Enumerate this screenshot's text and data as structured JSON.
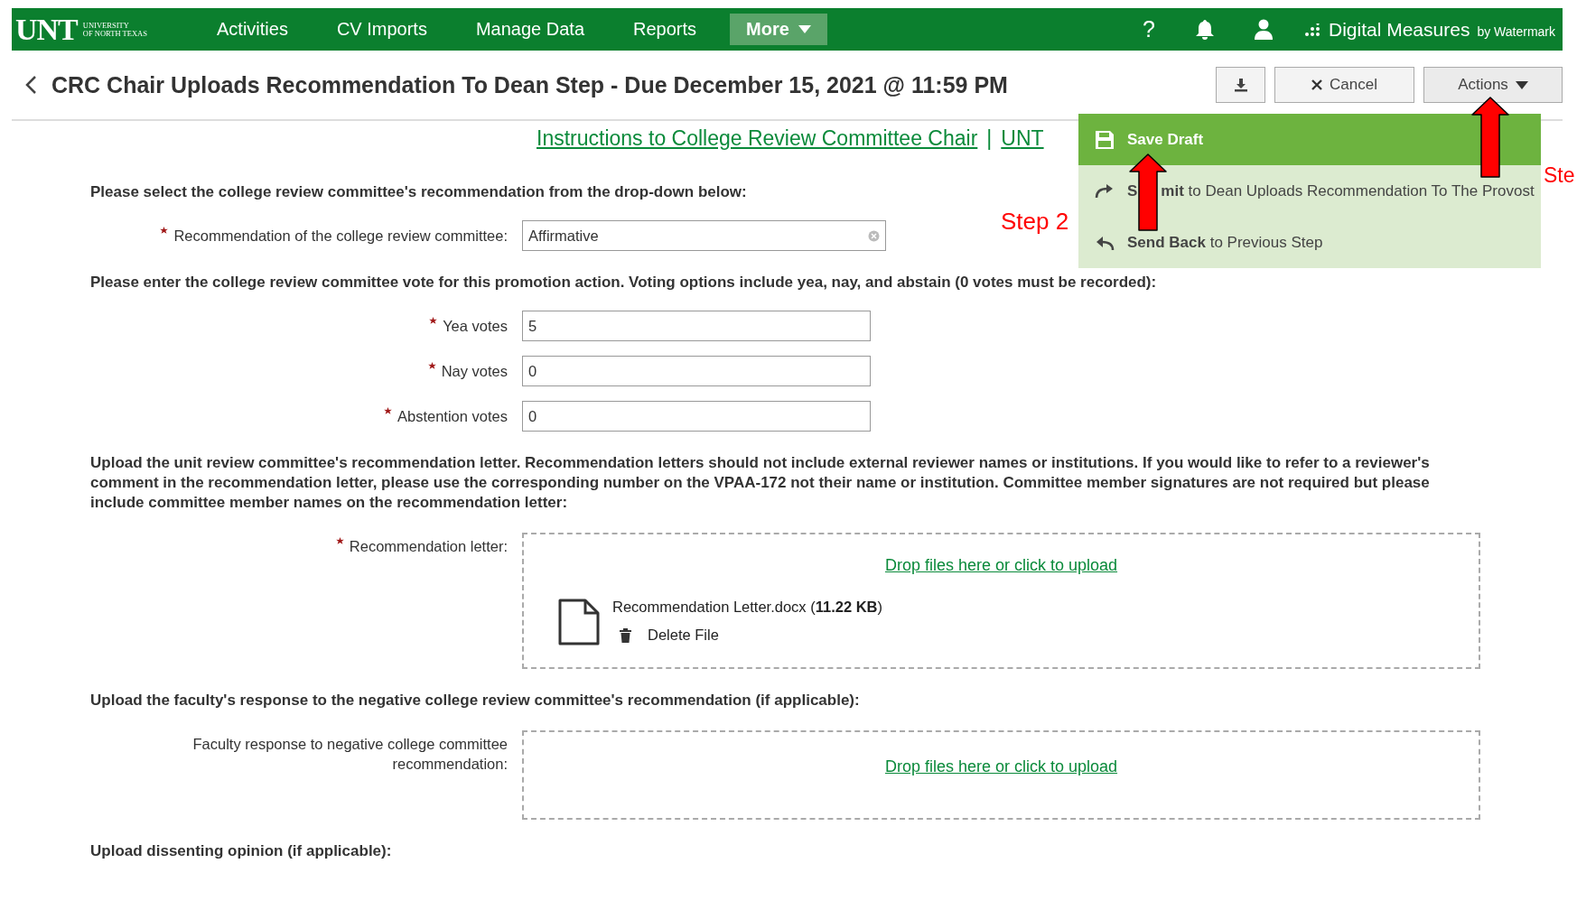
{
  "nav": {
    "logo": {
      "mark": "UNT",
      "sub": [
        "UNIVERSITY",
        "OF NORTH TEXAS"
      ]
    },
    "items": [
      {
        "label": "Activities",
        "kind": "link"
      },
      {
        "label": "CV Imports",
        "kind": "link"
      },
      {
        "label": "Manage Data",
        "kind": "link"
      },
      {
        "label": "Reports",
        "kind": "link"
      },
      {
        "label": "More",
        "kind": "dropdown"
      }
    ],
    "icons": [
      {
        "kind": "help",
        "label": "?"
      },
      {
        "kind": "bell"
      },
      {
        "kind": "user"
      }
    ],
    "brand": {
      "name": "Digital Measures",
      "by": "by Watermark"
    }
  },
  "header": {
    "title": "CRC Chair Uploads Recommendation To Dean Step - Due December 15, 2021 @ 11:59 PM",
    "buttons": [
      {
        "kind": "download"
      },
      {
        "kind": "cancel",
        "label": "Cancel"
      },
      {
        "kind": "dropdown",
        "label": "Actions",
        "expanded": true
      }
    ]
  },
  "links": [
    {
      "label": "Instructions to College Review Committee Chair"
    },
    {
      "label": "UNT"
    }
  ],
  "link_separator": "|",
  "actions_menu": {
    "items": [
      {
        "kind": "save",
        "label": "Save Draft",
        "highlighted": true
      },
      {
        "kind": "submit",
        "label": [
          "**S**",
          "**mit** to Dean Uploads Recommendation To The Provost"
        ],
        "highlighted": false
      },
      {
        "kind": "back",
        "label": "**Send Back** to Previous Step",
        "highlighted": false
      }
    ]
  },
  "form": [
    {
      "kind": "instruction",
      "text": "Please select the college review committee's recommendation from the drop-down below:"
    },
    {
      "kind": "select",
      "label": "Recommendation of the college review committee:",
      "required": true,
      "value": "Affirmative"
    },
    {
      "kind": "instruction",
      "text": "Please enter the college review committee vote for this promotion action.  Voting options include yea, nay, and abstain (0 votes must be recorded):"
    },
    {
      "kind": "text",
      "label": "Yea votes",
      "required": true,
      "value": "5"
    },
    {
      "kind": "text",
      "label": "Nay votes",
      "required": true,
      "value": "0"
    },
    {
      "kind": "text",
      "label": "Abstention votes",
      "required": true,
      "value": "0"
    },
    {
      "kind": "instruction",
      "text": "Upload the unit review committee's recommendation letter. Recommendation letters should not include external reviewer names or institutions.  If you would like to refer to a reviewer's comment in the recommendation letter, please use the corresponding number on the VPAA-172 not their name or institution. Committee member signatures are not required but please include committee member names on the recommendation letter:"
    },
    {
      "kind": "upload",
      "label": "Recommendation letter:",
      "required": true,
      "prompt": "Drop files here or click to upload",
      "files": [
        {
          "name": "Recommendation Letter.docx (**11.22 KB**)",
          "delete": "Delete File"
        }
      ]
    },
    {
      "kind": "instruction",
      "text": "Upload the faculty's response to the negative college review committee's recommendation (if applicable):"
    },
    {
      "kind": "upload",
      "label": "Faculty response to negative college committee recommendation:",
      "required": false,
      "prompt": "Drop files here or click to upload"
    },
    {
      "kind": "instruction",
      "text": "Upload dissenting opinion (if applicable):"
    }
  ],
  "annotations": [
    {
      "kind": "arrow"
    },
    {
      "kind": "arrow"
    },
    {
      "kind": "text",
      "text": "Step 2"
    },
    {
      "kind": "text",
      "text": "Ste"
    }
  ]
}
